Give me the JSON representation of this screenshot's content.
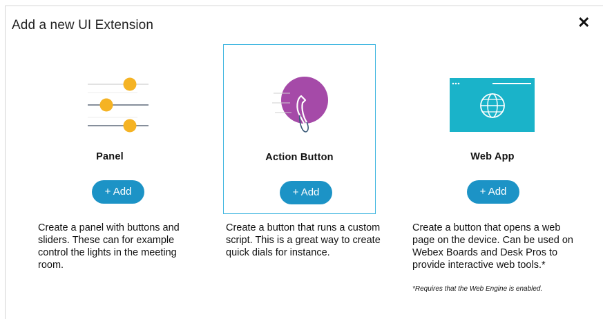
{
  "dialog": {
    "title": "Add a new UI Extension",
    "close_symbol": "✕"
  },
  "cards": [
    {
      "name": "Panel",
      "add_label": "+ Add",
      "icon": "sliders-icon",
      "description": "Create a panel with buttons and sliders. These can for example control the lights in the meeting room."
    },
    {
      "name": "Action Button",
      "add_label": "+ Add",
      "icon": "phone-action-icon",
      "selected": true,
      "description": "Create a button that runs a custom script. This is a great way to create quick dials for instance."
    },
    {
      "name": "Web App",
      "add_label": "+ Add",
      "icon": "web-app-icon",
      "description": "Create a button that opens a web page on the device. Can be used on Webex Boards and Desk Pros to provide interactive web tools.*"
    }
  ],
  "footnote": "*Requires that the Web Engine is enabled.",
  "colors": {
    "accent": "#1c93c6",
    "selection_border": "#3fb6e0",
    "slider_knob": "#f5b324",
    "action_circle": "#a54aa8",
    "web_app_tile": "#1ab3c9"
  }
}
